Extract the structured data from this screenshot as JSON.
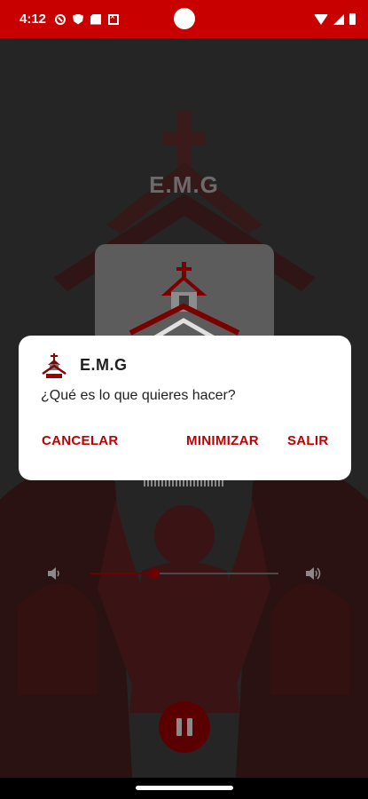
{
  "status": {
    "time": "4:12",
    "left_icons": [
      "do-not-disturb-icon",
      "shield-icon",
      "sim-icon",
      "notification-icon"
    ],
    "right_icons": [
      "wifi-icon",
      "signal-icon",
      "battery-icon"
    ]
  },
  "player": {
    "app_title": "E.M.G",
    "volume_level": 0.34,
    "volume_min_icon": "volume-low-icon",
    "volume_max_icon": "volume-high-icon",
    "state_icon": "pause-icon"
  },
  "dialog": {
    "title": "E.M.G",
    "message": "¿Qué es lo que quieres hacer?",
    "cancel_label": "CANCELAR",
    "minimize_label": "MINIMIZAR",
    "exit_label": "SALIR"
  },
  "colors": {
    "accent": "#c80000",
    "dialog_button": "#c00000",
    "background": "#252525"
  }
}
